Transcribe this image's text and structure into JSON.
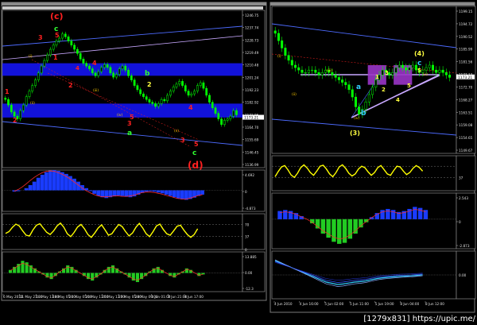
{
  "colors": {
    "background": "#000000",
    "frame": "#9a9a9a",
    "candle": "#00ff00",
    "wave_red": "#ff2020",
    "wave_green": "#30ff30",
    "wave_yellow": "#ffff40",
    "wave_cyan": "#33ccff",
    "zone_blue": "#1515ff",
    "zone_purple": "#9a35c8",
    "osc_yellow": "#ffff00",
    "hist_blue": "#1a3cff",
    "hist_green": "#22cc22",
    "signal_red": "#ff2a2a",
    "price_tag": "#ffffff",
    "trendline_blue": "#4d6bff",
    "trendline_lilac": "#c8a8ff"
  },
  "watermark": "[1279x831] https://upic.me/",
  "chart_data": [
    {
      "id": "left-price",
      "type": "candlestick",
      "ylim": [
        1136.99,
        1250.0
      ],
      "yticks": [
        "1246.75",
        "1237.74",
        "1228.73",
        "1219.49",
        "1210.48",
        "1201.24",
        "1192.23",
        "1182.92",
        "1173.95",
        "1164.70",
        "1155.69",
        "1146.45",
        "1136.99"
      ],
      "price_tag": "1173.21",
      "close_series": [
        1186,
        1182,
        1177,
        1174,
        1172,
        1178,
        1182,
        1188,
        1192,
        1196,
        1200,
        1205,
        1210,
        1214,
        1218,
        1222,
        1225,
        1228,
        1230,
        1233,
        1231,
        1228,
        1225,
        1222,
        1219,
        1215,
        1212,
        1210,
        1208,
        1205,
        1203,
        1206,
        1209,
        1211,
        1209,
        1205,
        1202,
        1204,
        1208,
        1210,
        1207,
        1203,
        1200,
        1196,
        1193,
        1190,
        1188,
        1186,
        1184,
        1183,
        1181,
        1183,
        1186,
        1185,
        1189,
        1192,
        1195,
        1197,
        1199,
        1196,
        1192,
        1189,
        1190,
        1192,
        1196,
        1198,
        1194,
        1189,
        1184,
        1180,
        1176,
        1172,
        1168,
        1171,
        1172,
        1174,
        1178,
        1175
      ],
      "bands": [
        [
          1203,
          1212
        ],
        [
          1173,
          1183
        ]
      ],
      "annotations": [
        {
          "text": "(c)",
          "color": "red"
        },
        {
          "text": "c",
          "color": "green"
        },
        {
          "text": "3",
          "color": "red"
        },
        {
          "text": "5",
          "color": "red"
        },
        {
          "text": "1",
          "color": "red"
        },
        {
          "text": "4",
          "color": "red"
        },
        {
          "text": "2",
          "color": "red"
        },
        {
          "text": "b",
          "color": "green"
        },
        {
          "text": "2",
          "color": "yellow"
        },
        {
          "text": "3",
          "color": "red"
        },
        {
          "text": "5",
          "color": "red"
        },
        {
          "text": "a",
          "color": "green"
        },
        {
          "text": "4",
          "color": "red"
        },
        {
          "text": "3",
          "color": "red"
        },
        {
          "text": "5",
          "color": "red"
        },
        {
          "text": "c",
          "color": "green"
        },
        {
          "text": "(d)",
          "color": "red"
        },
        {
          "text": "1",
          "color": "red"
        },
        {
          "text": "2",
          "color": "red"
        },
        {
          "text": "4",
          "color": "red"
        }
      ],
      "sub_labels": [
        "(i)",
        "(ii)",
        "(iii)",
        "(iv)",
        "(v)"
      ],
      "xticks": [
        "6 May 2010",
        "11 May 21:00",
        "13 May 13:00",
        "18 May 05:00",
        "20 May 05:00",
        "21 May 13:00",
        "25 May 13:00",
        "27 May 05:00",
        "28 May 09:00",
        "1 Jun 01:00",
        "2 Jun 21:00",
        "4 Jun 17:00"
      ]
    },
    {
      "id": "left-osc-1",
      "type": "area",
      "ylim": [
        -4.873,
        4.692
      ],
      "yticks": [
        "4.692",
        "0",
        "-4.873"
      ],
      "values": [
        -0.3,
        -0.2,
        0,
        0.5,
        1.2,
        2.0,
        2.9,
        3.6,
        4.2,
        4.6,
        4.69,
        4.5,
        4.2,
        3.8,
        3.3,
        2.7,
        2.0,
        1.2,
        0.5,
        -0.2,
        -0.8,
        -1.3,
        -1.6,
        -1.8,
        -1.6,
        -1.4,
        -1.2,
        -1.3,
        -1.5,
        -1.6,
        -1.4,
        -1.0,
        -0.6,
        -0.3,
        -0.2,
        -0.3,
        -0.5,
        -0.7,
        -1.0,
        -1.3,
        -1.6,
        -1.9,
        -2.1,
        -2.2,
        -2.0,
        -1.7,
        -1.3,
        -1.0
      ],
      "signal": [
        -0.2,
        0.2,
        0.8,
        1.5,
        2.3,
        3.0,
        3.6,
        4.1,
        4.4,
        4.5,
        4.4,
        4.1,
        3.7,
        3.2,
        2.6,
        1.9,
        1.2,
        0.5,
        -0.1,
        -0.6,
        -1.0,
        -1.3,
        -1.5,
        -1.5,
        -1.4,
        -1.3,
        -1.3,
        -1.4,
        -1.4,
        -1.3,
        -1.1,
        -0.8,
        -0.5,
        -0.4,
        -0.4,
        -0.5,
        -0.7,
        -0.9,
        -1.2,
        -1.4,
        -1.7,
        -1.9,
        -2.0,
        -2.0,
        -1.8,
        -1.5,
        -1.2,
        -1.0
      ]
    },
    {
      "id": "left-osc-2",
      "type": "line",
      "ylim": [
        0,
        100
      ],
      "yticks": [
        "70",
        "37",
        "0"
      ],
      "levels": [
        70,
        37
      ],
      "values": [
        45,
        50,
        62,
        71,
        66,
        52,
        40,
        38,
        55,
        68,
        72,
        60,
        48,
        42,
        52,
        66,
        74,
        62,
        44,
        36,
        48,
        63,
        70,
        58,
        42,
        34,
        46,
        60,
        69,
        55,
        40,
        44,
        58,
        70,
        64,
        50,
        38,
        46,
        62,
        73,
        60,
        44,
        36,
        50,
        66,
        71,
        56,
        44,
        40,
        52,
        65,
        68,
        54,
        42,
        34,
        42,
        58
      ]
    },
    {
      "id": "left-osc-3",
      "type": "histogram",
      "ylim": [
        -12.3,
        13.885
      ],
      "yticks": [
        "13.885",
        "0.00",
        "-12.3"
      ],
      "values": [
        2,
        4,
        6,
        8,
        7,
        5,
        3,
        1,
        -1,
        -3,
        -4,
        -2,
        1,
        3,
        5,
        4,
        2,
        0,
        -2,
        -4,
        -5,
        -3,
        -1,
        2,
        4,
        5,
        3,
        1,
        -1,
        -3,
        -5,
        -6,
        -4,
        -2,
        1,
        3,
        4,
        2,
        0,
        -2,
        -3,
        -1,
        1,
        3,
        2,
        0,
        -2,
        -1
      ]
    },
    {
      "id": "right-price",
      "type": "candlestick",
      "ylim": [
        1142.0,
        1202.0
      ],
      "yticks": [
        "1199.15",
        "1194.72",
        "1190.52",
        "1185.99",
        "1181.56",
        "1177.13",
        "1172.70",
        "1168.27",
        "1163.51",
        "1159.08",
        "1154.65",
        "1149.67"
      ],
      "price_tag": "1173.21",
      "close_series": [
        1191,
        1188,
        1185,
        1182,
        1180,
        1178,
        1177,
        1176,
        1175,
        1175,
        1176,
        1176,
        1175,
        1174,
        1175,
        1176,
        1175,
        1174,
        1173,
        1172,
        1171,
        1170,
        1168,
        1165,
        1161,
        1158,
        1160,
        1163,
        1166,
        1169,
        1172,
        1174,
        1176,
        1175,
        1174,
        1175,
        1177,
        1178,
        1177,
        1176,
        1177,
        1178,
        1176,
        1175,
        1176,
        1177,
        1178,
        1176,
        1175,
        1176,
        1175,
        1174,
        1173
      ],
      "zones": [
        [
          1170,
          1178
        ]
      ],
      "annotations": [
        {
          "text": "(4)",
          "color": "yellow"
        },
        {
          "text": "c",
          "color": "cyan"
        },
        {
          "text": "5",
          "color": "yellow"
        },
        {
          "text": "a",
          "color": "cyan"
        },
        {
          "text": "b",
          "color": "cyan"
        },
        {
          "text": "(3)",
          "color": "yellow"
        },
        {
          "text": "1",
          "color": "yellow"
        },
        {
          "text": "2",
          "color": "yellow"
        },
        {
          "text": "3",
          "color": "yellow"
        },
        {
          "text": "4",
          "color": "yellow"
        },
        {
          "text": "5",
          "color": "yellow"
        }
      ],
      "sub_labels": [
        "(i)",
        "(ii)",
        "(iii)",
        "(iv)",
        "(v)"
      ],
      "xticks": [
        "4 Jun 2010",
        "4 Jun 16:00",
        "5 Jun 02:00",
        "5 Jun 11:00",
        "5 Jun 19:00",
        "8 Jun 04:00",
        "8 Jun 12:00"
      ]
    },
    {
      "id": "right-osc-1",
      "type": "line",
      "ylim": [
        0,
        100
      ],
      "yticks": [
        "37"
      ],
      "levels": [
        70,
        37
      ],
      "values": [
        40,
        55,
        68,
        72,
        60,
        45,
        38,
        50,
        66,
        74,
        65,
        52,
        44,
        56,
        70,
        73,
        62,
        48,
        40,
        52,
        68,
        74,
        64,
        50,
        42,
        48,
        62,
        70,
        66,
        54,
        44,
        52,
        66,
        72,
        60,
        48,
        44,
        58,
        70,
        68,
        56,
        46,
        52,
        64,
        72,
        66,
        56
      ]
    },
    {
      "id": "right-osc-2",
      "type": "histogram",
      "ylim": [
        -2.873,
        2.543
      ],
      "yticks": [
        "2.543",
        "0",
        "-2.873"
      ],
      "values": [
        0.8,
        0.9,
        0.8,
        0.6,
        0.3,
        0.0,
        -0.4,
        -0.9,
        -1.4,
        -1.8,
        -2.2,
        -2.4,
        -2.3,
        -1.9,
        -1.4,
        -0.8,
        -0.3,
        0.2,
        0.6,
        0.9,
        1.0,
        0.9,
        0.7,
        0.8,
        1.0,
        1.2,
        1.1,
        0.9
      ]
    },
    {
      "id": "right-osc-3",
      "type": "line",
      "ylim": [
        -1.0,
        1.0
      ],
      "yticks": [
        "0.00"
      ],
      "values": [
        0.6,
        0.5,
        0.4,
        0.3,
        0.2,
        0.1,
        0.0,
        -0.1,
        -0.2,
        -0.3,
        -0.35,
        -0.4,
        -0.38,
        -0.34,
        -0.3,
        -0.28,
        -0.25,
        -0.2,
        -0.15,
        -0.12,
        -0.1,
        -0.08,
        -0.06,
        -0.05,
        -0.04,
        -0.02,
        0.0
      ]
    }
  ]
}
